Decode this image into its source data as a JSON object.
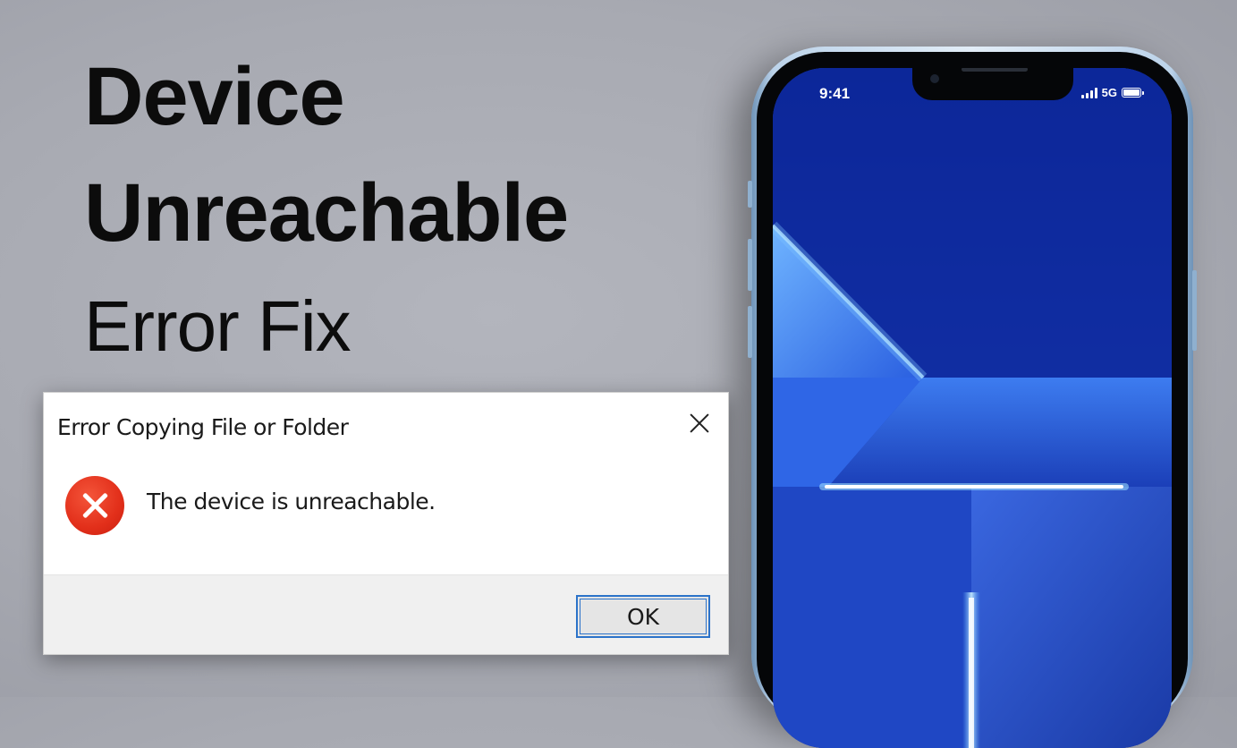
{
  "headline": {
    "line1": "Device",
    "line2": "Unreachable",
    "line3": "Error Fix"
  },
  "phone": {
    "status_time": "9:41",
    "network": "5G",
    "icons": [
      "signal-bars-icon",
      "battery-icon"
    ]
  },
  "dialog": {
    "title": "Error Copying File or Folder",
    "message": "The device is unreachable.",
    "ok_label": "OK",
    "icons": [
      "close-icon",
      "error-icon"
    ]
  },
  "colors": {
    "background": "#a8aab2",
    "error_red": "#e22f1a",
    "button_focus": "#2c73c9",
    "screen_blue": "#1f3fae"
  }
}
